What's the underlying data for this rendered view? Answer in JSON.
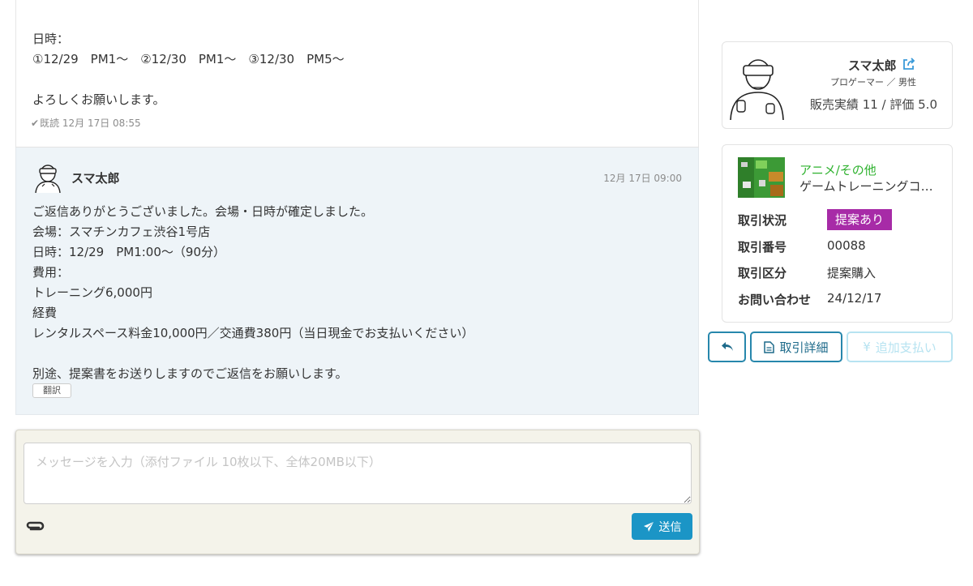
{
  "thread": {
    "prev_message": {
      "lines": [
        "日時：",
        "①12/29　PM1～　②12/30　PM1～　③12/30　PM5～",
        "",
        "よろしくお願いします。"
      ],
      "read_status": "既読 12月 17日 08:55"
    },
    "message": {
      "sender": "スマ太郎",
      "time": "12月 17日 09:00",
      "lines": [
        "ご返信ありがとうございました。会場・日時が確定しました。",
        "会場：スマチンカフェ渋谷1号店",
        "日時：12/29　PM1:00～（90分）",
        "費用：",
        "トレーニング6,000円",
        "経費",
        "レンタルスペース料金10,000円／交通費380円（当日現金でお支払いください）",
        "",
        "別途、提案書をお送りしますのでご返信をお願いします。"
      ],
      "translate_label": "翻訳"
    }
  },
  "compose": {
    "placeholder": "メッセージを入力（添付ファイル 10枚以下、全体20MB以下）",
    "send_label": "送信"
  },
  "profile": {
    "name": "スマ太郎",
    "role": "プロゲーマー ／ 男性",
    "stats": "販売実績 11 / 評価 5.0"
  },
  "deal": {
    "category": "アニメ/その他",
    "product": "ゲームトレーニングコーチ",
    "rows": [
      {
        "label": "取引状況",
        "value": "提案あり"
      },
      {
        "label": "取引番号",
        "value": "00088"
      },
      {
        "label": "取引区分",
        "value": "提案購入"
      },
      {
        "label": "お問い合わせ",
        "value": "24/12/17"
      }
    ],
    "status_color": "#a72ba7",
    "category_color": "#2fb22f"
  },
  "actions": {
    "detail_label": "取引詳細",
    "pay_label": "追加支払い"
  }
}
